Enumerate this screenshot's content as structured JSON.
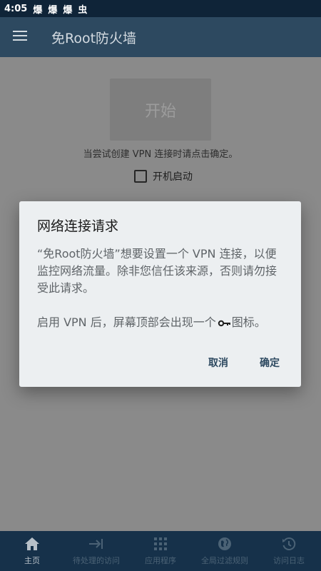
{
  "status_bar": {
    "time": "4:05",
    "icons": [
      "爆",
      "爆",
      "爆",
      "虫"
    ]
  },
  "app_bar": {
    "title": "免Root防火墙",
    "menu_icon": "menu-icon"
  },
  "main": {
    "start_button_label": "开始",
    "hint_text": "当尝试创建 VPN 连接时请点击确定。",
    "boot_label": "开机启动",
    "boot_checked": false
  },
  "dialog": {
    "title": "网络连接请求",
    "body_para1": "“免Root防火墙”想要设置一个 VPN 连接，以便监控网络流量。除非您信任该来源，否则请勿接受此请求。",
    "body_para2_before": "启用 VPN 后，屏幕顶部会出现一个",
    "body_para2_after": "图标。",
    "cancel_label": "取消",
    "ok_label": "确定"
  },
  "bottom_nav": {
    "items": [
      {
        "label": "主页",
        "icon": "home-icon",
        "active": true
      },
      {
        "label": "待处理的访问",
        "icon": "arrow-to-bar-icon",
        "active": false
      },
      {
        "label": "应用程序",
        "icon": "apps-grid-icon",
        "active": false
      },
      {
        "label": "全局过滤规则",
        "icon": "globe-icon",
        "active": false
      },
      {
        "label": "访问日志",
        "icon": "history-icon",
        "active": false
      }
    ]
  },
  "colors": {
    "status_bar": "#0f2438",
    "app_bar": "#2d4960",
    "scrim_background": "#8a8a8a",
    "dialog_background": "#eceff1",
    "accent": "#2d4960",
    "bottom_nav": "#16314a"
  }
}
